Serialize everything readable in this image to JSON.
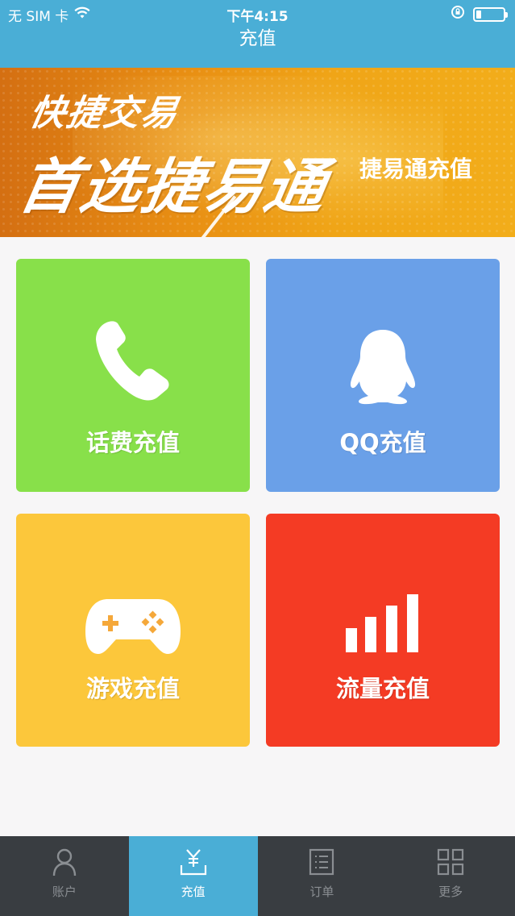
{
  "status_bar": {
    "carrier": "无 SIM 卡",
    "time": "下午4:15",
    "battery_level": 0.2
  },
  "nav": {
    "title": "充值"
  },
  "banner": {
    "line1": "快捷交易",
    "line2": "首选捷易通",
    "side_text": "捷易通充值"
  },
  "tiles": [
    {
      "label": "话费充值",
      "icon": "phone-icon",
      "color": "#88e04a"
    },
    {
      "label": "QQ充值",
      "icon": "qq-penguin-icon",
      "color": "#6aa0e8"
    },
    {
      "label": "游戏充值",
      "icon": "gamepad-icon",
      "color": "#fcc73b"
    },
    {
      "label": "流量充值",
      "icon": "signal-bars-icon",
      "color": "#f43b24"
    }
  ],
  "tabbar": {
    "items": [
      {
        "label": "账户",
        "icon": "user-icon",
        "active": false
      },
      {
        "label": "充值",
        "icon": "recharge-icon",
        "active": true
      },
      {
        "label": "订单",
        "icon": "order-list-icon",
        "active": false
      },
      {
        "label": "更多",
        "icon": "grid-icon",
        "active": false
      }
    ]
  },
  "colors": {
    "primary": "#4aaed6",
    "tabbar_bg": "#393d41",
    "page_bg": "#f7f6f7"
  }
}
